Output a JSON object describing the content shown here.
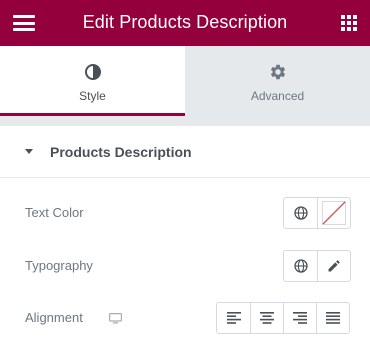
{
  "header": {
    "title": "Edit Products Description",
    "menu_icon": "hamburger-menu-icon",
    "apps_icon": "grid-apps-icon",
    "accent_color": "#93003c"
  },
  "tabs": [
    {
      "label": "Style",
      "icon": "contrast-half-circle-icon",
      "active": true
    },
    {
      "label": "Advanced",
      "icon": "gear-icon",
      "active": false
    }
  ],
  "section": {
    "title": "Products Description",
    "icon": "caret-down-icon",
    "expanded": true
  },
  "controls": {
    "text_color": {
      "label": "Text Color",
      "global_icon": "globe-icon",
      "swatch": "empty-color-swatch-icon"
    },
    "typography": {
      "label": "Typography",
      "global_icon": "globe-icon",
      "edit_icon": "pencil-icon"
    },
    "alignment": {
      "label": "Alignment",
      "device_icon": "desktop-monitor-icon",
      "options": [
        "align-left-icon",
        "align-center-icon",
        "align-right-icon",
        "align-justify-icon"
      ]
    }
  }
}
